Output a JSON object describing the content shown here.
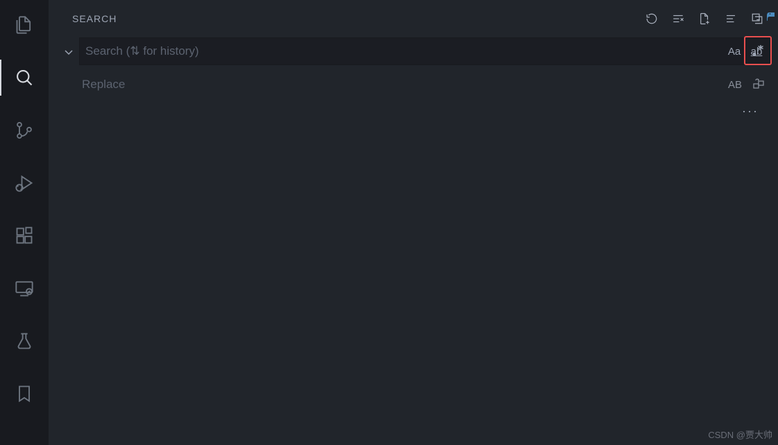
{
  "activityBar": {
    "items": [
      {
        "name": "explorer",
        "active": false
      },
      {
        "name": "search",
        "active": true
      },
      {
        "name": "source-control",
        "active": false
      },
      {
        "name": "run-debug",
        "active": false
      },
      {
        "name": "extensions",
        "active": false
      },
      {
        "name": "remote-explorer",
        "active": false
      },
      {
        "name": "testing",
        "active": false
      },
      {
        "name": "bookmarks",
        "active": false
      }
    ]
  },
  "sidebar": {
    "title": "SEARCH",
    "headerActions": {
      "refresh": "Refresh",
      "clearAll": "Clear Search Results",
      "newFile": "Open New Search Editor",
      "viewAsTree": "View as Tree",
      "collapseAll": "Collapse All"
    }
  },
  "search": {
    "placeholder": "Search (⇅ for history)",
    "value": "",
    "options": {
      "matchCase": "Aa",
      "wholeWord": "ab",
      "regex": ".*"
    }
  },
  "replace": {
    "placeholder": "Replace",
    "options": {
      "preserveCase": "AB"
    }
  },
  "moreOptions": "···",
  "watermark": "CSDN @贾大帅"
}
